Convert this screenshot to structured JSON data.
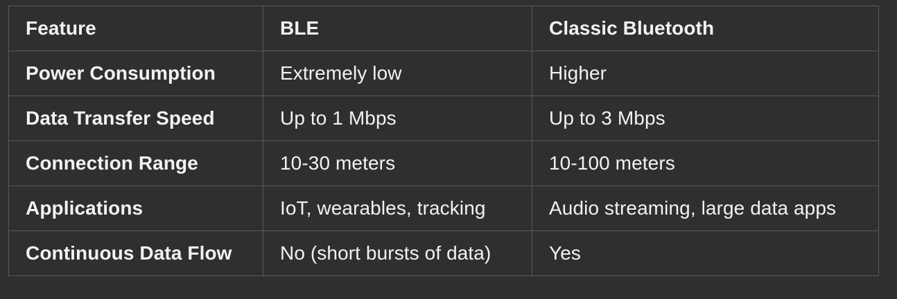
{
  "table": {
    "headers": [
      "Feature",
      "BLE",
      "Classic Bluetooth"
    ],
    "rows": [
      [
        "Power Consumption",
        "Extremely low",
        "Higher"
      ],
      [
        "Data Transfer Speed",
        "Up to 1 Mbps",
        "Up to 3 Mbps"
      ],
      [
        "Connection Range",
        "10-30 meters",
        "10-100 meters"
      ],
      [
        "Applications",
        "IoT, wearables, tracking",
        "Audio streaming, large data apps"
      ],
      [
        "Continuous Data Flow",
        "No (short bursts of data)",
        "Yes"
      ]
    ]
  },
  "colors": {
    "background": "#2f2f2f",
    "text": "#f2f2f2",
    "border": "#5a5a5a"
  }
}
